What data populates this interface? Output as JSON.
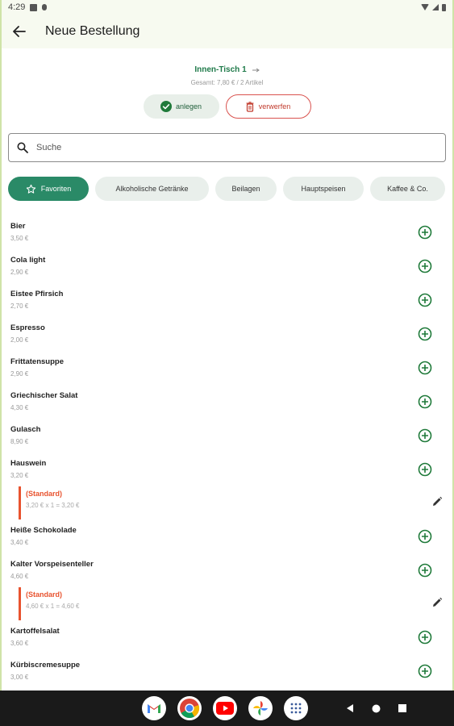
{
  "status_bar": {
    "time": "4:29"
  },
  "app_bar": {
    "title": "Neue Bestellung"
  },
  "table": {
    "name": "Innen-Tisch 1",
    "summary": "Gesamt: 7,80 € / 2 Artikel"
  },
  "actions": {
    "create_label": "anlegen",
    "discard_label": "verwerfen"
  },
  "search": {
    "placeholder": "Suche"
  },
  "categories": [
    {
      "label": "Favoriten"
    },
    {
      "label": "Alkoholische Getränke"
    },
    {
      "label": "Beilagen"
    },
    {
      "label": "Hauptspeisen"
    },
    {
      "label": "Kaffee & Co."
    }
  ],
  "products": [
    {
      "name": "Bier",
      "price": "3,50 €"
    },
    {
      "name": "Cola light",
      "price": "2,90 €"
    },
    {
      "name": "Eistee Pfirsich",
      "price": "2,70 €"
    },
    {
      "name": "Espresso",
      "price": "2,00 €"
    },
    {
      "name": "Frittatensuppe",
      "price": "2,90 €"
    },
    {
      "name": "Griechischer Salat",
      "price": "4,30 €"
    },
    {
      "name": "Gulasch",
      "price": "8,90 €"
    },
    {
      "name": "Hauswein",
      "price": "3,20 €",
      "order": {
        "variant": "(Standard)",
        "calc": "3,20 € x 1 = 3,20 €"
      }
    },
    {
      "name": "Heiße Schokolade",
      "price": "3,40 €"
    },
    {
      "name": "Kalter Vorspeisenteller",
      "price": "4,60 €",
      "order": {
        "variant": "(Standard)",
        "calc": "4,60 € x 1 = 4,60 €"
      }
    },
    {
      "name": "Kartoffelsalat",
      "price": "3,60 €"
    },
    {
      "name": "Kürbiscremesuppe",
      "price": "3,00 €"
    }
  ],
  "colors": {
    "accent": "#2a8a67",
    "warning": "#e8532f",
    "discard": "#c0392b"
  }
}
